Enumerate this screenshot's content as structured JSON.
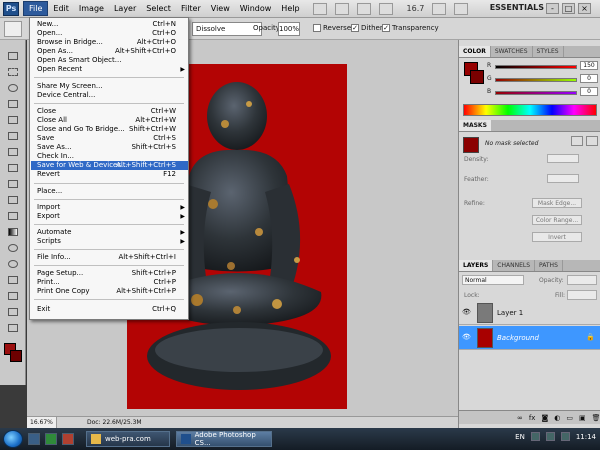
{
  "menubar": {
    "logo": "Ps",
    "items": [
      "File",
      "Edit",
      "Image",
      "Layer",
      "Select",
      "Filter",
      "View",
      "Window",
      "Help"
    ],
    "zoom": "16.7",
    "workspace": "ESSENTIALS",
    "window_buttons": [
      "-",
      "□",
      "×"
    ]
  },
  "options": {
    "mode": "Dissolve",
    "opacity_label": "Opacity:",
    "opacity_value": "100%",
    "reverse_label": "Reverse",
    "dither_label": "Dither",
    "transparency_label": "Transparency"
  },
  "file_menu": [
    {
      "label": "New...",
      "shortcut": "Ctrl+N"
    },
    {
      "label": "Open...",
      "shortcut": "Ctrl+O"
    },
    {
      "label": "Browse in Bridge...",
      "shortcut": "Alt+Ctrl+O"
    },
    {
      "label": "Open As...",
      "shortcut": "Alt+Shift+Ctrl+O"
    },
    {
      "label": "Open As Smart Object...",
      "shortcut": ""
    },
    {
      "label": "Open Recent",
      "shortcut": "",
      "submenu": true
    },
    {
      "label": "Share My Screen...",
      "shortcut": ""
    },
    {
      "label": "Device Central...",
      "shortcut": ""
    },
    {
      "label": "Close",
      "shortcut": "Ctrl+W"
    },
    {
      "label": "Close All",
      "shortcut": "Alt+Ctrl+W"
    },
    {
      "label": "Close and Go To Bridge...",
      "shortcut": "Shift+Ctrl+W"
    },
    {
      "label": "Save",
      "shortcut": "Ctrl+S"
    },
    {
      "label": "Save As...",
      "shortcut": "Shift+Ctrl+S"
    },
    {
      "label": "Check In...",
      "shortcut": ""
    },
    {
      "label": "Save for Web & Devices...",
      "shortcut": "Alt+Shift+Ctrl+S",
      "highlighted": true
    },
    {
      "label": "Revert",
      "shortcut": "F12"
    },
    {
      "label": "Place...",
      "shortcut": ""
    },
    {
      "label": "Import",
      "shortcut": "",
      "submenu": true
    },
    {
      "label": "Export",
      "shortcut": "",
      "submenu": true
    },
    {
      "label": "Automate",
      "shortcut": "",
      "submenu": true
    },
    {
      "label": "Scripts",
      "shortcut": "",
      "submenu": true
    },
    {
      "label": "File Info...",
      "shortcut": "Alt+Shift+Ctrl+I"
    },
    {
      "label": "Page Setup...",
      "shortcut": "Shift+Ctrl+P"
    },
    {
      "label": "Print...",
      "shortcut": "Ctrl+P"
    },
    {
      "label": "Print One Copy",
      "shortcut": "Alt+Shift+Ctrl+P"
    },
    {
      "label": "Exit",
      "shortcut": "Ctrl+Q"
    }
  ],
  "color_panel": {
    "tabs": [
      "COLOR",
      "SWATCHES",
      "STYLES"
    ],
    "r": "150",
    "g": "0",
    "b": "0",
    "r_label": "R",
    "g_label": "G",
    "b_label": "B",
    "color": "#960000"
  },
  "masks_panel": {
    "title": "MASKS",
    "status": "No mask selected",
    "density_label": "Density:",
    "feather_label": "Feather:",
    "refine_label": "Refine:",
    "mask_edge_btn": "Mask Edge...",
    "color_range_btn": "Color Range...",
    "invert_btn": "Invert"
  },
  "layers_panel": {
    "tabs": [
      "LAYERS",
      "CHANNELS",
      "PATHS"
    ],
    "blend_mode": "Normal",
    "opacity_label": "Opacity:",
    "lock_label": "Lock:",
    "fill_label": "Fill:",
    "layers": [
      {
        "name": "Layer 1",
        "selected": false
      },
      {
        "name": "Background",
        "selected": true
      }
    ]
  },
  "status": {
    "zoom": "16.67%",
    "doc": "Doc: 22.6M/25.3M"
  },
  "taskbar": {
    "items": [
      {
        "label": "web-pra.com",
        "active": false
      },
      {
        "label": "Adobe Photoshop CS...",
        "active": true
      }
    ],
    "lang": "EN",
    "time": "11:14"
  }
}
